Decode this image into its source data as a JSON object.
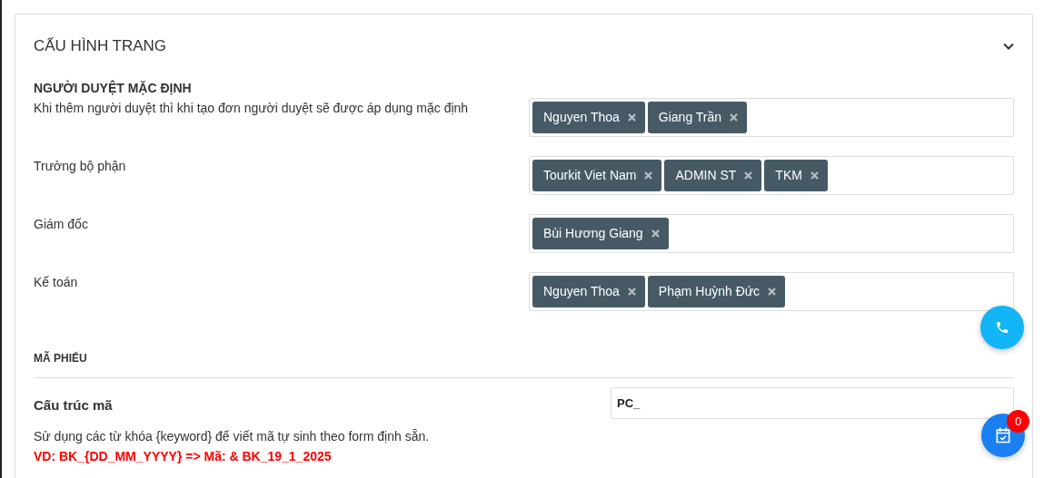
{
  "card": {
    "title": "CẤU HÌNH TRANG",
    "expanded": true
  },
  "approvers": {
    "heading": "NGƯỜI DUYỆT MẶC ĐỊNH",
    "rows": [
      {
        "label": "Khi thêm người duyệt thì khi tạo đơn người duyệt sẽ được áp dụng mặc định",
        "tags": [
          "Nguyen Thoa",
          "Giang Trần"
        ]
      },
      {
        "label": "Trưởng bộ phận",
        "tags": [
          "Tourkit Viet Nam",
          "ADMIN ST",
          "TKM"
        ]
      },
      {
        "label": "Giám đốc",
        "tags": [
          "Bùi Hương Giang"
        ]
      },
      {
        "label": "Kế toán",
        "tags": [
          "Nguyen Thoa",
          "Phạm Huỳnh Đức"
        ]
      }
    ]
  },
  "code_section": {
    "heading": "MÃ PHIẾU",
    "label": "Cấu trúc mã",
    "value": "PC_",
    "help": "Sử dụng các từ khóa {keyword} để viết mã tự sinh theo form định sẵn.",
    "example": "VD: BK_{DD_MM_YYYY} => Mã: & BK_19_1_2025"
  },
  "floating": {
    "task_badge": "0"
  }
}
